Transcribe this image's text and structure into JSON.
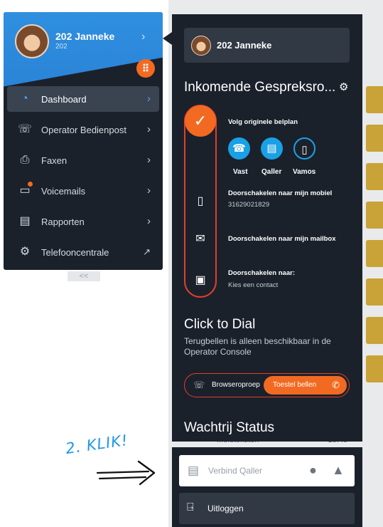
{
  "sidebar": {
    "user": {
      "name": "202 Janneke",
      "extension": "202"
    },
    "items": [
      {
        "label": "Dashboard",
        "icon": "dashboard-pie-icon",
        "active": true
      },
      {
        "label": "Operator Bedienpost",
        "icon": "operator-phone-icon"
      },
      {
        "label": "Faxen",
        "icon": "fax-icon"
      },
      {
        "label": "Voicemails",
        "icon": "voicemail-icon",
        "badge": true
      },
      {
        "label": "Rapporten",
        "icon": "report-icon"
      },
      {
        "label": "Telefooncentrale",
        "icon": "gear-icon",
        "external": true
      }
    ],
    "collapse_label": "<<"
  },
  "panel": {
    "user_name": "202 Janneke",
    "incoming": {
      "title": "Inkomende Gespreksro...",
      "options": [
        {
          "title": "Volg originele belplan",
          "selected": true
        },
        {
          "title": "Doorschakelen naar mijn mobiel",
          "subtitle": "31629021829"
        },
        {
          "title": "Doorschakelen naar mijn mailbox"
        },
        {
          "title": "Doorschakelen naar:",
          "subtitle": "Kies een contact"
        }
      ],
      "devices": [
        {
          "label": "Vast",
          "icon": "desk-phone-icon",
          "enabled": true
        },
        {
          "label": "Qaller",
          "icon": "qaller-icon",
          "enabled": true
        },
        {
          "label": "Vamos",
          "icon": "mobile-phone-icon",
          "enabled": false
        }
      ]
    },
    "click_to_dial": {
      "title": "Click to Dial",
      "subtitle": "Terugbellen is alleen beschikbaar in de Operator Console",
      "left_option": "Browseroproep",
      "right_option": "Toestel bellen"
    },
    "queue": {
      "title": "Wachtrij Status"
    }
  },
  "background": {
    "row_left": "Meldteksten",
    "row_right": "18:45"
  },
  "bottom": {
    "qaller_placeholder": "Verbind Qaller",
    "logout_label": "Uitloggen"
  },
  "annotation": {
    "text": "2. KLIK!"
  },
  "colors": {
    "accent_orange": "#f26a21",
    "accent_blue": "#1aa0e6",
    "panel_bg": "#1b212b",
    "header_blue": "#2f8fe0"
  }
}
